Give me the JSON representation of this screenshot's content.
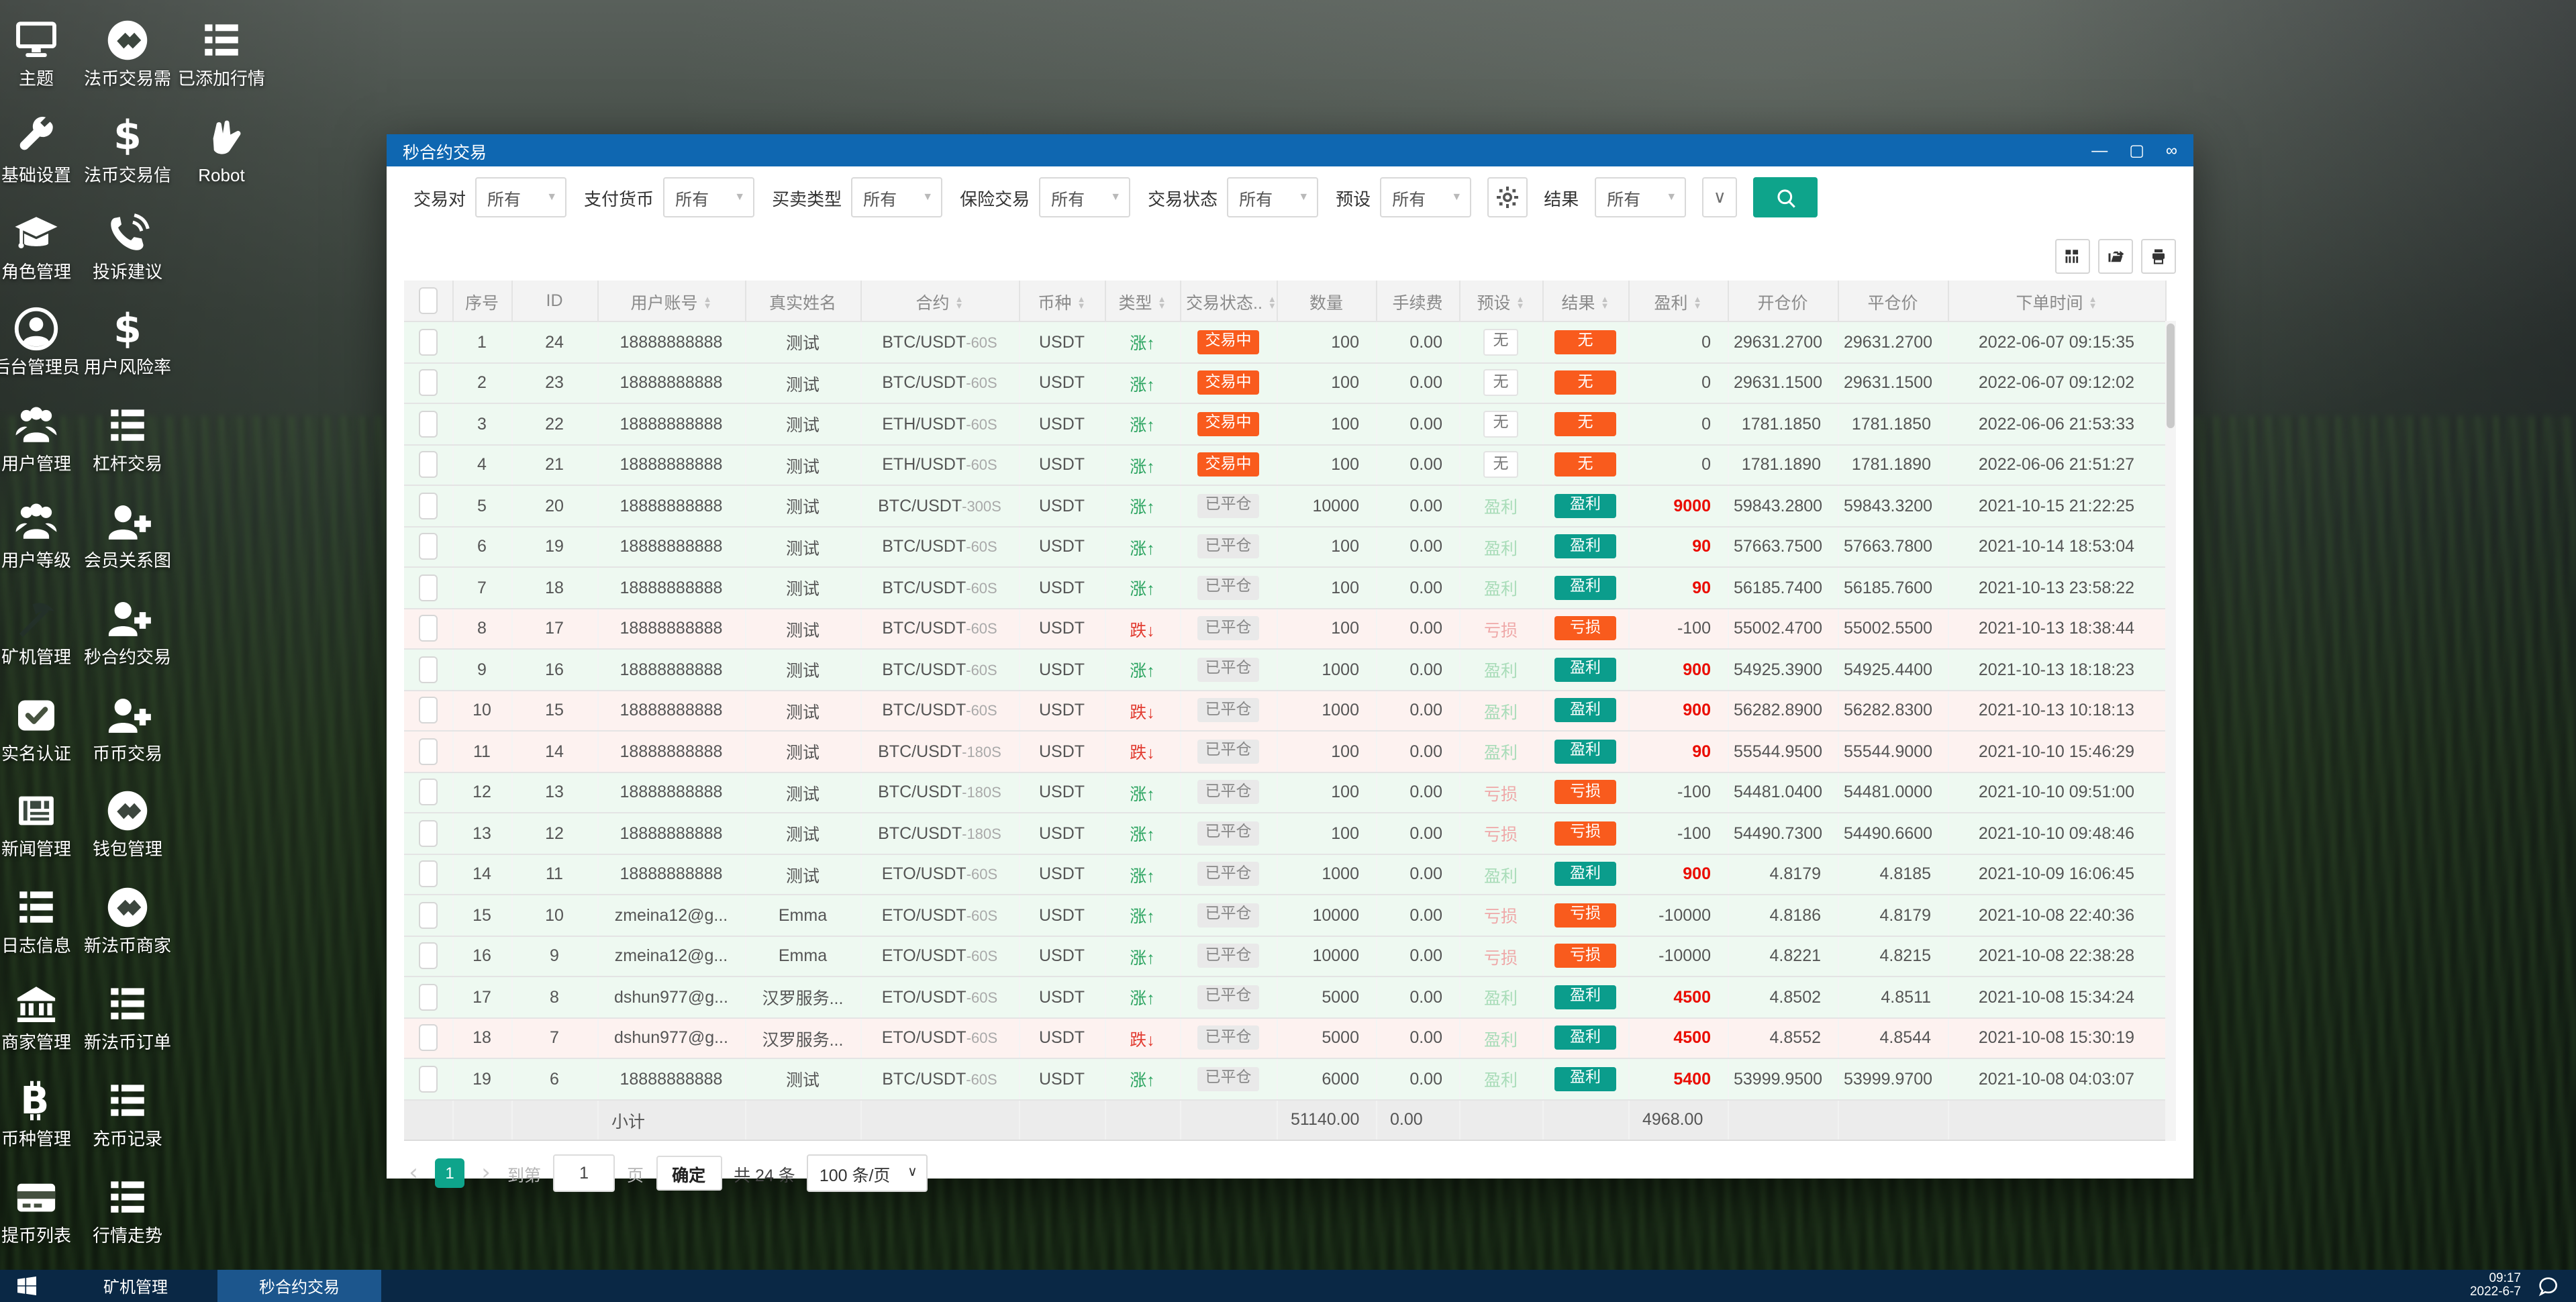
{
  "desktop": {
    "items": [
      {
        "label": "主题",
        "icon": "monitor",
        "col": 0,
        "row": 0
      },
      {
        "label": "法币交易需",
        "icon": "gem",
        "col": 1,
        "row": 0
      },
      {
        "label": "已添加行情",
        "icon": "list",
        "col": 2,
        "row": 0
      },
      {
        "label": "基础设置",
        "icon": "wrench",
        "col": 0,
        "row": 1
      },
      {
        "label": "法币交易信",
        "icon": "dollar",
        "col": 1,
        "row": 1
      },
      {
        "label": "Robot",
        "icon": "hand",
        "col": 2,
        "row": 1
      },
      {
        "label": "角色管理",
        "icon": "cap",
        "col": 0,
        "row": 2
      },
      {
        "label": "投诉建议",
        "icon": "phone",
        "col": 1,
        "row": 2
      },
      {
        "label": "后台管理员",
        "icon": "admin",
        "col": 0,
        "row": 3
      },
      {
        "label": "用户风险率",
        "icon": "dollar",
        "col": 1,
        "row": 3
      },
      {
        "label": "用户管理",
        "icon": "users",
        "col": 0,
        "row": 4
      },
      {
        "label": "杠杆交易",
        "icon": "list",
        "col": 1,
        "row": 4
      },
      {
        "label": "用户等级",
        "icon": "users",
        "col": 0,
        "row": 5
      },
      {
        "label": "会员关系图",
        "icon": "userplus",
        "col": 1,
        "row": 5
      },
      {
        "label": "矿机管理",
        "icon": "pickaxe",
        "col": 0,
        "row": 6
      },
      {
        "label": "秒合约交易",
        "icon": "userplus",
        "col": 1,
        "row": 6
      },
      {
        "label": "实名认证",
        "icon": "check",
        "col": 0,
        "row": 7
      },
      {
        "label": "币币交易",
        "icon": "userplus",
        "col": 1,
        "row": 7
      },
      {
        "label": "新闻管理",
        "icon": "news",
        "col": 0,
        "row": 8
      },
      {
        "label": "钱包管理",
        "icon": "gem",
        "col": 1,
        "row": 8
      },
      {
        "label": "日志信息",
        "icon": "list",
        "col": 0,
        "row": 9
      },
      {
        "label": "新法币商家",
        "icon": "gem",
        "col": 1,
        "row": 9
      },
      {
        "label": "商家管理",
        "icon": "bank",
        "col": 0,
        "row": 10
      },
      {
        "label": "新法币订单",
        "icon": "list",
        "col": 1,
        "row": 10
      },
      {
        "label": "币种管理",
        "icon": "bitcoin",
        "col": 0,
        "row": 11
      },
      {
        "label": "充币记录",
        "icon": "list",
        "col": 1,
        "row": 11
      },
      {
        "label": "提币列表",
        "icon": "card",
        "col": 0,
        "row": 12
      },
      {
        "label": "行情走势",
        "icon": "list",
        "col": 1,
        "row": 12
      }
    ]
  },
  "window": {
    "title": "秒合约交易",
    "controls": {
      "minimize": "—",
      "maximize": "▢",
      "pin": "∞"
    },
    "filters": [
      {
        "label": "交易对",
        "value": "所有"
      },
      {
        "label": "支付货币",
        "value": "所有"
      },
      {
        "label": "买卖类型",
        "value": "所有"
      },
      {
        "label": "保险交易",
        "value": "所有"
      },
      {
        "label": "交易状态",
        "value": "所有"
      },
      {
        "label": "预设",
        "value": "所有"
      }
    ],
    "result_filter": {
      "label": "结果",
      "value": "所有"
    },
    "accent_teal": "#0ea48b",
    "accent_orange": "#f95b1d",
    "titlebar_blue": "#0f67b1",
    "table": {
      "headers": [
        {
          "label": "",
          "type": "checkbox"
        },
        {
          "label": "序号"
        },
        {
          "label": "ID"
        },
        {
          "label": "用户账号",
          "sortable": true
        },
        {
          "label": "真实姓名"
        },
        {
          "label": "合约",
          "sortable": true
        },
        {
          "label": "币种",
          "sortable": true
        },
        {
          "label": "类型",
          "sortable": true
        },
        {
          "label": "交易状态..",
          "sortable": true
        },
        {
          "label": "数量"
        },
        {
          "label": "手续费"
        },
        {
          "label": "预设",
          "sortable": true
        },
        {
          "label": "结果",
          "sortable": true
        },
        {
          "label": "盈利",
          "sortable": true
        },
        {
          "label": "开仓价"
        },
        {
          "label": "平仓价"
        },
        {
          "label": "下单时间",
          "sortable": true
        }
      ],
      "rows": [
        {
          "n": "1",
          "id": "24",
          "account": "18888888888",
          "name": "测试",
          "pair": "BTC/USDT",
          "period": "-60S",
          "coin": "USDT",
          "type": "up",
          "type_label": "涨↑",
          "status": "trading",
          "status_label": "交易中",
          "qty": "100",
          "fee": "0.00",
          "preset": "none",
          "preset_label": "无",
          "result": "none",
          "result_label": "无",
          "profit": "0",
          "hot": false,
          "open": "29631.2700",
          "close": "29631.2700",
          "time": "2022-06-07 09:15:35",
          "tone": "green"
        },
        {
          "n": "2",
          "id": "23",
          "account": "18888888888",
          "name": "测试",
          "pair": "BTC/USDT",
          "period": "-60S",
          "coin": "USDT",
          "type": "up",
          "type_label": "涨↑",
          "status": "trading",
          "status_label": "交易中",
          "qty": "100",
          "fee": "0.00",
          "preset": "none",
          "preset_label": "无",
          "result": "none",
          "result_label": "无",
          "profit": "0",
          "hot": false,
          "open": "29631.1500",
          "close": "29631.1500",
          "time": "2022-06-07 09:12:02",
          "tone": "green"
        },
        {
          "n": "3",
          "id": "22",
          "account": "18888888888",
          "name": "测试",
          "pair": "ETH/USDT",
          "period": "-60S",
          "coin": "USDT",
          "type": "up",
          "type_label": "涨↑",
          "status": "trading",
          "status_label": "交易中",
          "qty": "100",
          "fee": "0.00",
          "preset": "none",
          "preset_label": "无",
          "result": "none",
          "result_label": "无",
          "profit": "0",
          "hot": false,
          "open": "1781.1850",
          "close": "1781.1850",
          "time": "2022-06-06 21:53:33",
          "tone": "green"
        },
        {
          "n": "4",
          "id": "21",
          "account": "18888888888",
          "name": "测试",
          "pair": "ETH/USDT",
          "period": "-60S",
          "coin": "USDT",
          "type": "up",
          "type_label": "涨↑",
          "status": "trading",
          "status_label": "交易中",
          "qty": "100",
          "fee": "0.00",
          "preset": "none",
          "preset_label": "无",
          "result": "none",
          "result_label": "无",
          "profit": "0",
          "hot": false,
          "open": "1781.1890",
          "close": "1781.1890",
          "time": "2022-06-06 21:51:27",
          "tone": "green"
        },
        {
          "n": "5",
          "id": "20",
          "account": "18888888888",
          "name": "测试",
          "pair": "BTC/USDT",
          "period": "-300S",
          "coin": "USDT",
          "type": "up",
          "type_label": "涨↑",
          "status": "closed",
          "status_label": "已平仓",
          "qty": "10000",
          "fee": "0.00",
          "preset": "win",
          "preset_label": "盈利",
          "result": "win",
          "result_label": "盈利",
          "profit": "9000",
          "hot": true,
          "open": "59843.2800",
          "close": "59843.3200",
          "time": "2021-10-15 21:22:25",
          "tone": "green"
        },
        {
          "n": "6",
          "id": "19",
          "account": "18888888888",
          "name": "测试",
          "pair": "BTC/USDT",
          "period": "-60S",
          "coin": "USDT",
          "type": "up",
          "type_label": "涨↑",
          "status": "closed",
          "status_label": "已平仓",
          "qty": "100",
          "fee": "0.00",
          "preset": "win",
          "preset_label": "盈利",
          "result": "win",
          "result_label": "盈利",
          "profit": "90",
          "hot": true,
          "open": "57663.7500",
          "close": "57663.7800",
          "time": "2021-10-14 18:53:04",
          "tone": "green"
        },
        {
          "n": "7",
          "id": "18",
          "account": "18888888888",
          "name": "测试",
          "pair": "BTC/USDT",
          "period": "-60S",
          "coin": "USDT",
          "type": "up",
          "type_label": "涨↑",
          "status": "closed",
          "status_label": "已平仓",
          "qty": "100",
          "fee": "0.00",
          "preset": "win",
          "preset_label": "盈利",
          "result": "win",
          "result_label": "盈利",
          "profit": "90",
          "hot": true,
          "open": "56185.7400",
          "close": "56185.7600",
          "time": "2021-10-13 23:58:22",
          "tone": "green"
        },
        {
          "n": "8",
          "id": "17",
          "account": "18888888888",
          "name": "测试",
          "pair": "BTC/USDT",
          "period": "-60S",
          "coin": "USDT",
          "type": "down",
          "type_label": "跌↓",
          "status": "closed",
          "status_label": "已平仓",
          "qty": "100",
          "fee": "0.00",
          "preset": "loss",
          "preset_label": "亏损",
          "result": "loss",
          "result_label": "亏损",
          "profit": "-100",
          "hot": false,
          "open": "55002.4700",
          "close": "55002.5500",
          "time": "2021-10-13 18:38:44",
          "tone": "pink"
        },
        {
          "n": "9",
          "id": "16",
          "account": "18888888888",
          "name": "测试",
          "pair": "BTC/USDT",
          "period": "-60S",
          "coin": "USDT",
          "type": "up",
          "type_label": "涨↑",
          "status": "closed",
          "status_label": "已平仓",
          "qty": "1000",
          "fee": "0.00",
          "preset": "win",
          "preset_label": "盈利",
          "result": "win",
          "result_label": "盈利",
          "profit": "900",
          "hot": true,
          "open": "54925.3900",
          "close": "54925.4400",
          "time": "2021-10-13 18:18:23",
          "tone": "green"
        },
        {
          "n": "10",
          "id": "15",
          "account": "18888888888",
          "name": "测试",
          "pair": "BTC/USDT",
          "period": "-60S",
          "coin": "USDT",
          "type": "down",
          "type_label": "跌↓",
          "status": "closed",
          "status_label": "已平仓",
          "qty": "1000",
          "fee": "0.00",
          "preset": "win",
          "preset_label": "盈利",
          "result": "win",
          "result_label": "盈利",
          "profit": "900",
          "hot": true,
          "open": "56282.8900",
          "close": "56282.8300",
          "time": "2021-10-13 10:18:13",
          "tone": "pink"
        },
        {
          "n": "11",
          "id": "14",
          "account": "18888888888",
          "name": "测试",
          "pair": "BTC/USDT",
          "period": "-180S",
          "coin": "USDT",
          "type": "down",
          "type_label": "跌↓",
          "status": "closed",
          "status_label": "已平仓",
          "qty": "100",
          "fee": "0.00",
          "preset": "win",
          "preset_label": "盈利",
          "result": "win",
          "result_label": "盈利",
          "profit": "90",
          "hot": true,
          "open": "55544.9500",
          "close": "55544.9000",
          "time": "2021-10-10 15:46:29",
          "tone": "pink"
        },
        {
          "n": "12",
          "id": "13",
          "account": "18888888888",
          "name": "测试",
          "pair": "BTC/USDT",
          "period": "-180S",
          "coin": "USDT",
          "type": "up",
          "type_label": "涨↑",
          "status": "closed",
          "status_label": "已平仓",
          "qty": "100",
          "fee": "0.00",
          "preset": "loss",
          "preset_label": "亏损",
          "result": "loss",
          "result_label": "亏损",
          "profit": "-100",
          "hot": false,
          "open": "54481.0400",
          "close": "54481.0000",
          "time": "2021-10-10 09:51:00",
          "tone": "green"
        },
        {
          "n": "13",
          "id": "12",
          "account": "18888888888",
          "name": "测试",
          "pair": "BTC/USDT",
          "period": "-180S",
          "coin": "USDT",
          "type": "up",
          "type_label": "涨↑",
          "status": "closed",
          "status_label": "已平仓",
          "qty": "100",
          "fee": "0.00",
          "preset": "loss",
          "preset_label": "亏损",
          "result": "loss",
          "result_label": "亏损",
          "profit": "-100",
          "hot": false,
          "open": "54490.7300",
          "close": "54490.6600",
          "time": "2021-10-10 09:48:46",
          "tone": "green"
        },
        {
          "n": "14",
          "id": "11",
          "account": "18888888888",
          "name": "测试",
          "pair": "ETO/USDT",
          "period": "-60S",
          "coin": "USDT",
          "type": "up",
          "type_label": "涨↑",
          "status": "closed",
          "status_label": "已平仓",
          "qty": "1000",
          "fee": "0.00",
          "preset": "win",
          "preset_label": "盈利",
          "result": "win",
          "result_label": "盈利",
          "profit": "900",
          "hot": true,
          "open": "4.8179",
          "close": "4.8185",
          "time": "2021-10-09 16:06:45",
          "tone": "green"
        },
        {
          "n": "15",
          "id": "10",
          "account": "zmeina12@g...",
          "name": "Emma",
          "pair": "ETO/USDT",
          "period": "-60S",
          "coin": "USDT",
          "type": "up",
          "type_label": "涨↑",
          "status": "closed",
          "status_label": "已平仓",
          "qty": "10000",
          "fee": "0.00",
          "preset": "loss",
          "preset_label": "亏损",
          "result": "loss",
          "result_label": "亏损",
          "profit": "-10000",
          "hot": false,
          "open": "4.8186",
          "close": "4.8179",
          "time": "2021-10-08 22:40:36",
          "tone": "green"
        },
        {
          "n": "16",
          "id": "9",
          "account": "zmeina12@g...",
          "name": "Emma",
          "pair": "ETO/USDT",
          "period": "-60S",
          "coin": "USDT",
          "type": "up",
          "type_label": "涨↑",
          "status": "closed",
          "status_label": "已平仓",
          "qty": "10000",
          "fee": "0.00",
          "preset": "loss",
          "preset_label": "亏损",
          "result": "loss",
          "result_label": "亏损",
          "profit": "-10000",
          "hot": false,
          "open": "4.8221",
          "close": "4.8215",
          "time": "2021-10-08 22:38:28",
          "tone": "green"
        },
        {
          "n": "17",
          "id": "8",
          "account": "dshun977@g...",
          "name": "汉罗服务...",
          "pair": "ETO/USDT",
          "period": "-60S",
          "coin": "USDT",
          "type": "up",
          "type_label": "涨↑",
          "status": "closed",
          "status_label": "已平仓",
          "qty": "5000",
          "fee": "0.00",
          "preset": "win",
          "preset_label": "盈利",
          "result": "win",
          "result_label": "盈利",
          "profit": "4500",
          "hot": true,
          "open": "4.8502",
          "close": "4.8511",
          "time": "2021-10-08 15:34:24",
          "tone": "green"
        },
        {
          "n": "18",
          "id": "7",
          "account": "dshun977@g...",
          "name": "汉罗服务...",
          "pair": "ETO/USDT",
          "period": "-60S",
          "coin": "USDT",
          "type": "down",
          "type_label": "跌↓",
          "status": "closed",
          "status_label": "已平仓",
          "qty": "5000",
          "fee": "0.00",
          "preset": "win",
          "preset_label": "盈利",
          "result": "win",
          "result_label": "盈利",
          "profit": "4500",
          "hot": true,
          "open": "4.8552",
          "close": "4.8544",
          "time": "2021-10-08 15:30:19",
          "tone": "pink"
        },
        {
          "n": "19",
          "id": "6",
          "account": "18888888888",
          "name": "测试",
          "pair": "BTC/USDT",
          "period": "-60S",
          "coin": "USDT",
          "type": "up",
          "type_label": "涨↑",
          "status": "closed",
          "status_label": "已平仓",
          "qty": "6000",
          "fee": "0.00",
          "preset": "win",
          "preset_label": "盈利",
          "result": "win",
          "result_label": "盈利",
          "profit": "5400",
          "hot": true,
          "open": "53999.9500",
          "close": "53999.9700",
          "time": "2021-10-08 04:03:07",
          "tone": "green"
        }
      ],
      "subtotal": {
        "label": "小计",
        "qty": "51140.00",
        "fee": "0.00",
        "profit": "4968.00"
      }
    },
    "pagination": {
      "prev": "‹",
      "page": "1",
      "next": "›",
      "goto_prefix": "到第",
      "goto_value": "1",
      "goto_suffix": "页",
      "confirm": "确定",
      "total": "共 24 条",
      "page_size": "100 条/页"
    }
  },
  "taskbar": {
    "items": [
      {
        "label": "矿机管理",
        "active": false
      },
      {
        "label": "秒合约交易",
        "active": true
      }
    ],
    "clock_time": "09:17",
    "clock_date": "2022-6-7"
  }
}
